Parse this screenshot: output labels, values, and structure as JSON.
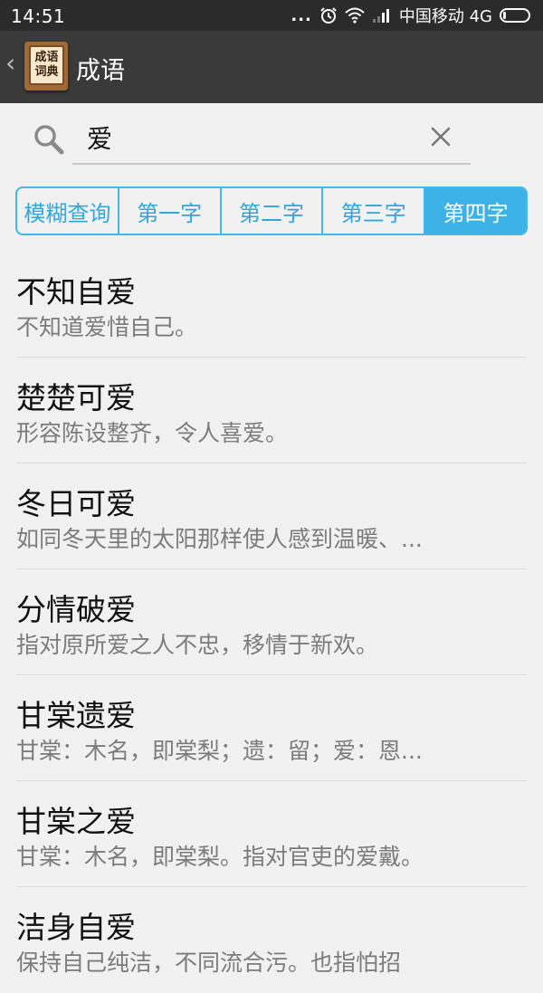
{
  "status_bar": {
    "time": "14:51",
    "dots": "...",
    "carrier": "中国移动 4G",
    "battery_level": 0.1
  },
  "app_bar": {
    "back_icon": "chevron-left-icon",
    "logo_line1": "成语",
    "logo_line2": "词典",
    "title": "成语"
  },
  "search": {
    "value": "爱",
    "search_icon": "search-icon",
    "clear_icon": "close-icon"
  },
  "tabs": [
    {
      "label": "模糊查询",
      "active": false
    },
    {
      "label": "第一字",
      "active": false
    },
    {
      "label": "第二字",
      "active": false
    },
    {
      "label": "第三字",
      "active": false
    },
    {
      "label": "第四字",
      "active": true
    }
  ],
  "results": [
    {
      "title": "不知自爱",
      "desc": "不知道爱惜自己。"
    },
    {
      "title": "楚楚可爱",
      "desc": "形容陈设整齐，令人喜爱。"
    },
    {
      "title": "冬日可爱",
      "desc": "如同冬天里的太阳那样使人感到温暖、..."
    },
    {
      "title": "分情破爱",
      "desc": "指对原所爱之人不忠，移情于新欢。"
    },
    {
      "title": "甘棠遗爱",
      "desc": "甘棠：木名，即棠梨；遗：留；爱：恩..."
    },
    {
      "title": "甘棠之爱",
      "desc": "甘棠：木名，即棠梨。指对官吏的爱戴。"
    },
    {
      "title": "洁身自爱",
      "desc": "保持自己纯洁，不同流合污。也指怕招"
    }
  ],
  "colors": {
    "accent": "#3cb2e6",
    "appbar": "#3a3a3a",
    "statusbar": "#2b2b2b"
  }
}
